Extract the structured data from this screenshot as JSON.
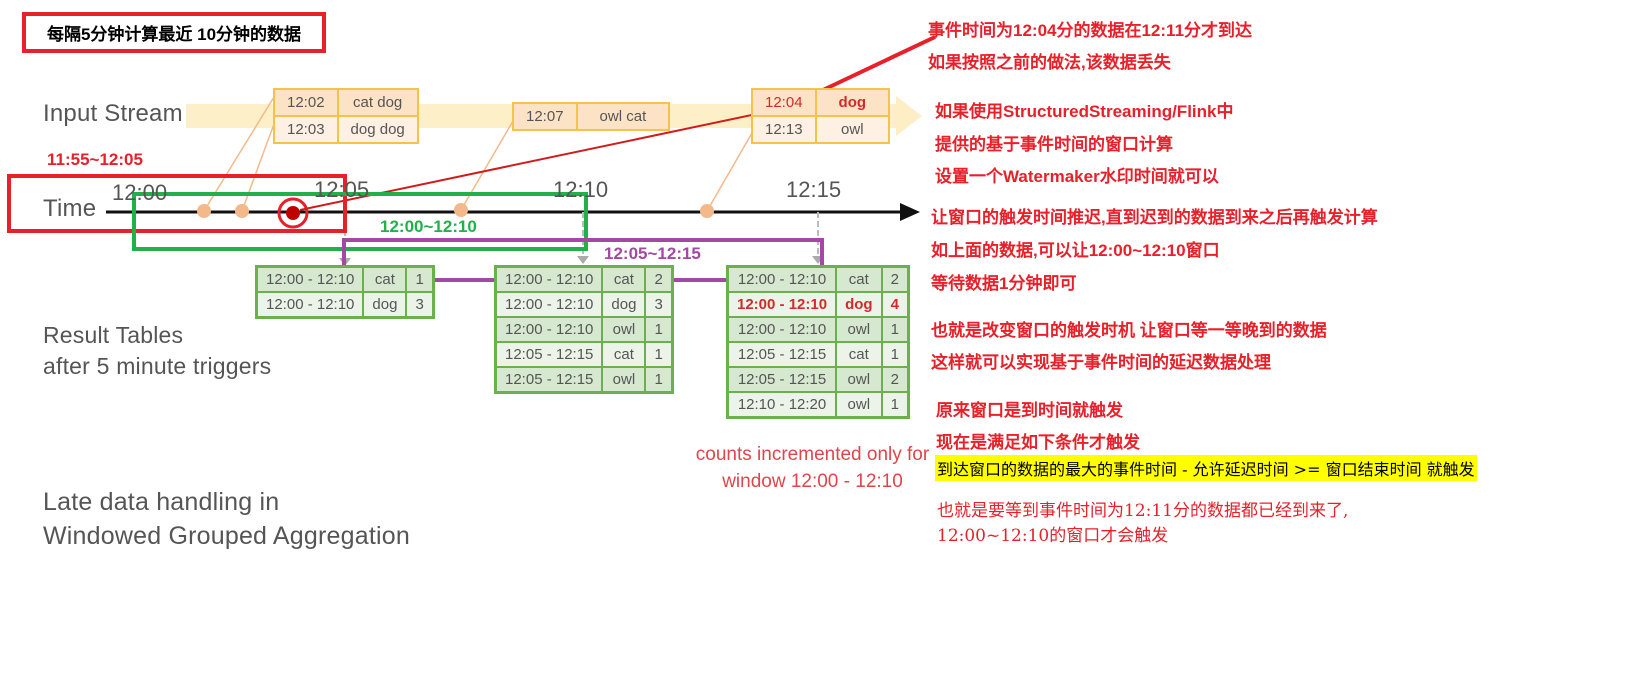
{
  "title_box": "每隔5分钟计算最近 10分钟的数据",
  "labels": {
    "input_stream": "Input Stream",
    "time": "Time",
    "result_tables_line1": "Result Tables",
    "result_tables_line2": "after 5 minute triggers",
    "late_line1": "Late data handling in",
    "late_line2": "Windowed Grouped Aggregation",
    "counts_note_line1": "counts incremented only for",
    "counts_note_line2": "window 12:00 - 12:10"
  },
  "timeline": {
    "ticks": [
      "12:00",
      "12:05",
      "12:10",
      "12:15"
    ]
  },
  "windows": {
    "red": "11:55~12:05",
    "green": "12:00~12:10",
    "purple": "12:05~12:15"
  },
  "input_events": [
    {
      "rows": [
        {
          "time": "12:02",
          "words": "cat dog"
        },
        {
          "time": "12:03",
          "words": "dog dog"
        }
      ]
    },
    {
      "rows": [
        {
          "time": "12:07",
          "words": "owl cat"
        }
      ]
    },
    {
      "rows": [
        {
          "time": "12:04",
          "words": "dog",
          "late": true
        },
        {
          "time": "12:13",
          "words": "owl"
        }
      ]
    }
  ],
  "result_tables": [
    {
      "rows": [
        {
          "window": "12:00 - 12:10",
          "word": "cat",
          "count": "1"
        },
        {
          "window": "12:00 - 12:10",
          "word": "dog",
          "count": "3"
        }
      ]
    },
    {
      "rows": [
        {
          "window": "12:00 - 12:10",
          "word": "cat",
          "count": "2"
        },
        {
          "window": "12:00 - 12:10",
          "word": "dog",
          "count": "3"
        },
        {
          "window": "12:00 - 12:10",
          "word": "owl",
          "count": "1"
        },
        {
          "window": "12:05 - 12:15",
          "word": "cat",
          "count": "1"
        },
        {
          "window": "12:05 - 12:15",
          "word": "owl",
          "count": "1"
        }
      ]
    },
    {
      "rows": [
        {
          "window": "12:00 - 12:10",
          "word": "cat",
          "count": "2"
        },
        {
          "window": "12:00 - 12:10",
          "word": "dog",
          "count": "4",
          "highlight": true
        },
        {
          "window": "12:00 - 12:10",
          "word": "owl",
          "count": "1"
        },
        {
          "window": "12:05 - 12:15",
          "word": "cat",
          "count": "1"
        },
        {
          "window": "12:05 - 12:15",
          "word": "owl",
          "count": "2"
        },
        {
          "window": "12:10 - 12:20",
          "word": "owl",
          "count": "1"
        }
      ]
    }
  ],
  "notes": [
    "事件时间为12:04分的数据在12:11分才到达",
    "如果按照之前的做法,该数据丢失",
    "如果使用StructuredStreaming/Flink中",
    "提供的基于事件时间的窗口计算",
    "设置一个Watermaker水印时间就可以",
    "让窗口的触发时间推迟,直到迟到的数据到来之后再触发计算",
    "如上面的数据,可以让12:00~12:10窗口",
    "等待数据1分钟即可",
    "也就是改变窗口的触发时机 让窗口等一等晚到的数据",
    "这样就可以实现基于事件时间的延迟数据处理",
    "原来窗口是到时间就触发",
    "现在是满足如下条件才触发"
  ],
  "condition": "到达窗口的数据的最大的事件时间 - 允许延迟时间 >= 窗口结束时间 就触发",
  "explain": [
    "也就是要等到事件时间为12:11分的数据都已经到来了,",
    "12:00~12:10的窗口才会触发"
  ],
  "colors": {
    "red": "#e8202a",
    "green": "#22b04a",
    "purple": "#a349a4",
    "stream": "#fdf0c8",
    "event_border": "#f6c24a",
    "result_border": "#6ab04c",
    "highlight": "#ffff00"
  }
}
